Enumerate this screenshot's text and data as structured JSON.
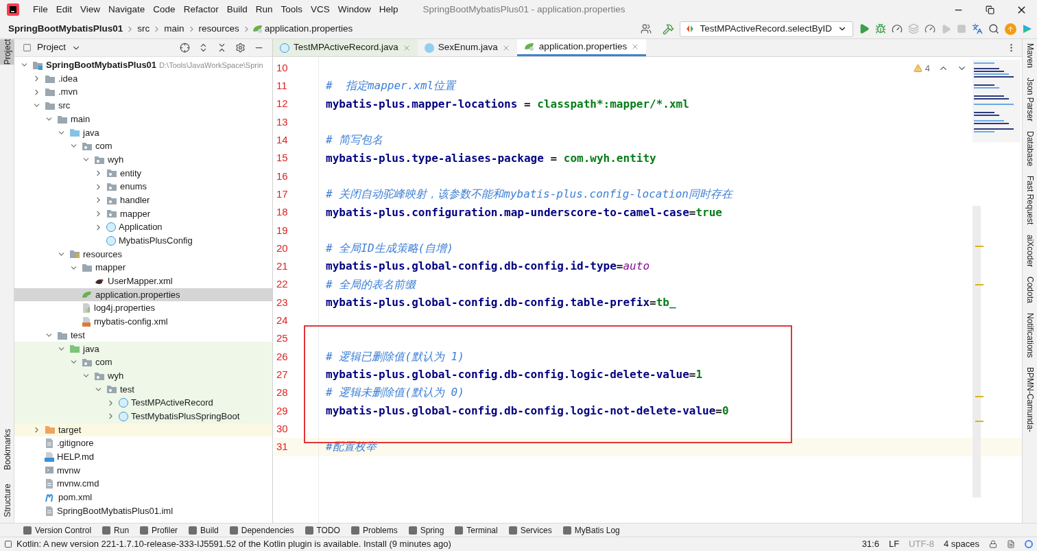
{
  "window": {
    "title": "SpringBootMybatisPlus01 - application.properties"
  },
  "menu": [
    "File",
    "Edit",
    "View",
    "Navigate",
    "Code",
    "Refactor",
    "Build",
    "Run",
    "Tools",
    "VCS",
    "Window",
    "Help"
  ],
  "breadcrumbs": [
    {
      "label": "SpringBootMybatisPlus01",
      "kind": "project"
    },
    {
      "label": "src",
      "kind": "folder"
    },
    {
      "label": "main",
      "kind": "folder"
    },
    {
      "label": "resources",
      "kind": "folder"
    },
    {
      "label": "application.properties",
      "kind": "file"
    }
  ],
  "run_config": {
    "label": "TestMPActiveRecord.selectByID"
  },
  "left_strip": [
    {
      "label": "Project",
      "selected": true
    },
    {
      "label": "Bookmarks",
      "selected": false
    },
    {
      "label": "Structure",
      "selected": false
    }
  ],
  "project": {
    "title": "Project",
    "tree": [
      {
        "label": "SpringBootMybatisPlus01",
        "path": "D:\\Tools\\JavaWorkSpace\\Sprin",
        "kind": "module",
        "expanded": true,
        "selected": false,
        "children": [
          {
            "label": ".idea",
            "kind": "folder",
            "expanded": false,
            "selected": false
          },
          {
            "label": ".mvn",
            "kind": "folder",
            "expanded": false,
            "selected": false
          },
          {
            "label": "src",
            "kind": "folder",
            "expanded": true,
            "selected": false,
            "children": [
              {
                "label": "main",
                "kind": "folder",
                "expanded": true,
                "selected": false,
                "children": [
                  {
                    "label": "java",
                    "kind": "source",
                    "expanded": true,
                    "selected": false,
                    "children": [
                      {
                        "label": "com",
                        "kind": "package",
                        "expanded": true,
                        "selected": false,
                        "children": [
                          {
                            "label": "wyh",
                            "kind": "package",
                            "expanded": true,
                            "selected": false,
                            "children": [
                              {
                                "label": "entity",
                                "kind": "package",
                                "expanded": false,
                                "selected": false
                              },
                              {
                                "label": "enums",
                                "kind": "package",
                                "expanded": false,
                                "selected": false
                              },
                              {
                                "label": "handler",
                                "kind": "package",
                                "expanded": false,
                                "selected": false
                              },
                              {
                                "label": "mapper",
                                "kind": "package",
                                "expanded": false,
                                "selected": false
                              },
                              {
                                "label": "Application",
                                "kind": "class",
                                "expanded": false,
                                "selected": false
                              },
                              {
                                "label": "MybatisPlusConfig",
                                "kind": "class",
                                "selected": false
                              }
                            ]
                          }
                        ]
                      }
                    ]
                  },
                  {
                    "label": "resources",
                    "kind": "resources",
                    "expanded": true,
                    "selected": false,
                    "children": [
                      {
                        "label": "mapper",
                        "kind": "folder",
                        "expanded": true,
                        "selected": false,
                        "children": [
                          {
                            "label": "UserMapper.xml",
                            "kind": "bird",
                            "selected": false
                          }
                        ]
                      },
                      {
                        "label": "application.properties",
                        "kind": "spring",
                        "selected": true
                      },
                      {
                        "label": "log4j.properties",
                        "kind": "properties",
                        "selected": false
                      },
                      {
                        "label": "mybatis-config.xml",
                        "kind": "xml",
                        "selected": false
                      }
                    ]
                  }
                ]
              },
              {
                "label": "test",
                "kind": "folder",
                "expanded": true,
                "selected": false,
                "children": [
                  {
                    "label": "java",
                    "kind": "test-source",
                    "color": "#eef7e8",
                    "expanded": true,
                    "selected": false,
                    "children": [
                      {
                        "label": "com",
                        "kind": "package",
                        "color": "#eef7e8",
                        "expanded": true,
                        "selected": false,
                        "children": [
                          {
                            "label": "wyh",
                            "kind": "package",
                            "color": "#eef7e8",
                            "expanded": true,
                            "selected": false,
                            "children": [
                              {
                                "label": "test",
                                "kind": "package",
                                "color": "#eef7e8",
                                "expanded": true,
                                "selected": false,
                                "children": [
                                  {
                                    "label": "TestMPActiveRecord",
                                    "kind": "class",
                                    "color": "#eef7e8",
                                    "expanded": false,
                                    "selected": false
                                  },
                                  {
                                    "label": "TestMybatisPlusSpringBoot",
                                    "kind": "class",
                                    "color": "#eef7e8",
                                    "expanded": false,
                                    "selected": false
                                  }
                                ]
                              }
                            ]
                          }
                        ]
                      }
                    ]
                  }
                ]
              }
            ]
          },
          {
            "label": "target",
            "kind": "excluded",
            "color": "#fbf9e3",
            "expanded": false,
            "selected": false
          },
          {
            "label": ".gitignore",
            "kind": "file",
            "selected": false
          },
          {
            "label": "HELP.md",
            "kind": "md",
            "selected": false
          },
          {
            "label": "mvnw",
            "kind": "script",
            "selected": false
          },
          {
            "label": "mvnw.cmd",
            "kind": "file",
            "selected": false
          },
          {
            "label": "pom.xml",
            "kind": "maven",
            "selected": false
          },
          {
            "label": "SpringBootMybatisPlus01.iml",
            "kind": "file",
            "selected": false
          }
        ]
      }
    ]
  },
  "tabs": [
    {
      "label": "TestMPActiveRecord.java",
      "kind": "class",
      "selected": false
    },
    {
      "label": "SexEnum.java",
      "kind": "enum",
      "selected": false
    },
    {
      "label": "application.properties",
      "kind": "spring",
      "selected": true
    }
  ],
  "editor": {
    "warnings": "4",
    "blocks": [
      {
        "annotated": false,
        "lines": [
          {
            "number": "10",
            "current": false
          },
          {
            "number": "11",
            "current": false,
            "tokens": [
              {
                "kind": "comment",
                "text": "#  指定mapper.xml位置"
              }
            ]
          },
          {
            "number": "12",
            "current": false,
            "tokens": [
              {
                "kind": "key",
                "text": "mybatis-plus.mapper-locations"
              },
              {
                "kind": "sep",
                "text": " = "
              },
              {
                "kind": "value",
                "text": "classpath*:mapper/*.xml"
              }
            ]
          },
          {
            "number": "13",
            "current": false
          },
          {
            "number": "14",
            "current": false,
            "tokens": [
              {
                "kind": "comment",
                "text": "# 简写包名"
              }
            ]
          },
          {
            "number": "15",
            "current": false,
            "tokens": [
              {
                "kind": "key",
                "text": "mybatis-plus.type-aliases-package"
              },
              {
                "kind": "sep",
                "text": " = "
              },
              {
                "kind": "value",
                "text": "com.wyh.entity"
              }
            ]
          },
          {
            "number": "16",
            "current": false
          },
          {
            "number": "17",
            "current": false,
            "tokens": [
              {
                "kind": "comment",
                "text": "# 关闭自动驼峰映射，该参数不能和mybatis-plus.config-location同时存在"
              }
            ]
          },
          {
            "number": "18",
            "current": false,
            "tokens": [
              {
                "kind": "key",
                "text": "mybatis-plus.configuration.map-underscore-to-camel-case"
              },
              {
                "kind": "sep",
                "text": "="
              },
              {
                "kind": "value",
                "text": "true"
              }
            ]
          },
          {
            "number": "19",
            "current": false
          },
          {
            "number": "20",
            "current": false,
            "tokens": [
              {
                "kind": "comment",
                "text": "# 全局ID生成策略(自增)"
              }
            ]
          },
          {
            "number": "21",
            "current": false,
            "tokens": [
              {
                "kind": "key",
                "text": "mybatis-plus.global-config.db-config.id-type"
              },
              {
                "kind": "sep",
                "text": "="
              },
              {
                "kind": "keyword",
                "text": "auto"
              }
            ]
          },
          {
            "number": "22",
            "current": false,
            "tokens": [
              {
                "kind": "comment",
                "text": "# 全局的表名前缀"
              }
            ]
          },
          {
            "number": "23",
            "current": false,
            "tokens": [
              {
                "kind": "key",
                "text": "mybatis-plus.global-config.db-config.table-prefix"
              },
              {
                "kind": "sep",
                "text": "="
              },
              {
                "kind": "value",
                "text": "tb_"
              }
            ]
          },
          {
            "number": "24",
            "current": false
          }
        ]
      },
      {
        "annotated": true,
        "lines": [
          {
            "number": "25",
            "current": false
          },
          {
            "number": "26",
            "current": false,
            "tokens": [
              {
                "kind": "comment",
                "text": "# 逻辑已删除值(默认为 1)"
              }
            ]
          },
          {
            "number": "27",
            "current": false,
            "tokens": [
              {
                "kind": "key",
                "text": "mybatis-plus.global-config.db-config.logic-delete-value"
              },
              {
                "kind": "sep",
                "text": "="
              },
              {
                "kind": "value",
                "text": "1"
              }
            ]
          },
          {
            "number": "28",
            "current": false,
            "tokens": [
              {
                "kind": "comment",
                "text": "# 逻辑未删除值(默认为 0)"
              }
            ]
          },
          {
            "number": "29",
            "current": false,
            "tokens": [
              {
                "kind": "key",
                "text": "mybatis-plus.global-config.db-config.logic-not-delete-value"
              },
              {
                "kind": "sep",
                "text": "="
              },
              {
                "kind": "value",
                "text": "0"
              }
            ]
          },
          {
            "number": "30",
            "current": false
          }
        ]
      },
      {
        "annotated": false,
        "lines": [
          {
            "number": "31",
            "current": true,
            "tokens": [
              {
                "kind": "comment",
                "text": "#配置枚举"
              }
            ]
          }
        ]
      }
    ]
  },
  "right_strip": [
    "Maven",
    "Json Parser",
    "Database",
    "Fast Request",
    "aiXcoder",
    "Codota",
    "Notifications",
    "BPMN-Camunda-"
  ],
  "tool_windows": [
    "Version Control",
    "Run",
    "Profiler",
    "Build",
    "Dependencies",
    "TODO",
    "Problems",
    "Spring",
    "Terminal",
    "Services",
    "MyBatis Log"
  ],
  "status_bar": {
    "message": "Kotlin: A new version 221-1.7.10-release-333-IJ5591.52 of the Kotlin plugin is available. Install (9 minutes ago)",
    "position": "31:6",
    "line_separator": "LF",
    "encoding": "UTF-8",
    "indent": "4 spaces"
  }
}
